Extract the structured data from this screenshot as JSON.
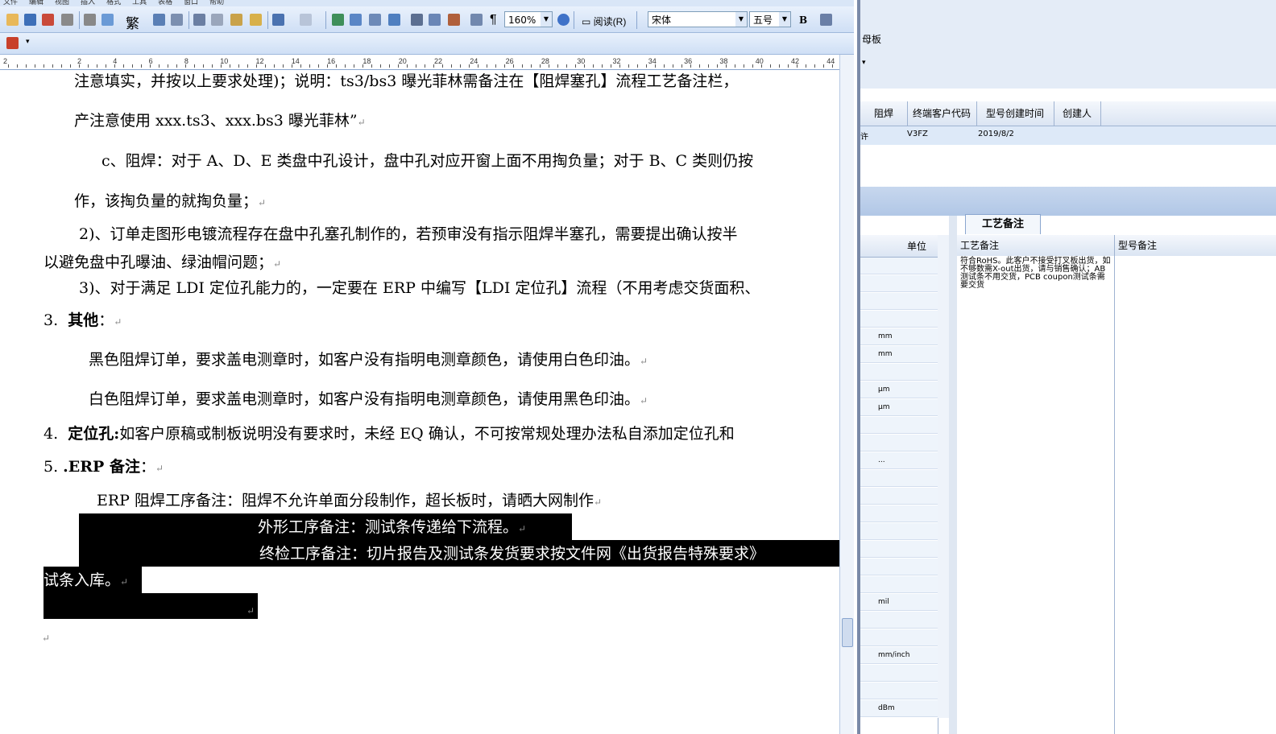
{
  "toolbar": {
    "zoom": "160%",
    "read_button": "阅读(R)",
    "font_name": "宋体",
    "font_size": "五号",
    "bold": "B",
    "trad": "繁"
  },
  "ruler": [
    "2",
    "2",
    "4",
    "6",
    "8",
    "10",
    "12",
    "14",
    "16",
    "18",
    "20",
    "22",
    "24",
    "26",
    "28",
    "30",
    "32",
    "34",
    "36",
    "38",
    "40",
    "42",
    "44"
  ],
  "document": {
    "line1": "注意填实，并按以上要求处理)；说明：ts3/bs3 曝光菲林需备注在【阻焊塞孔】流程工艺备注栏，",
    "line2": "产注意使用 xxx.ts3、xxx.bs3 曝光菲林”",
    "line3": "c、阻焊：对于 A、D、E 类盘中孔设计，盘中孔对应开窗上面不用掏负量；对于 B、C 类则仍按",
    "line4": "作，该掏负量的就掏负量；",
    "line5": "2)、订单走图形电镀流程存在盘中孔塞孔制作的，若预审没有指示阻焊半塞孔，需要提出确认按半",
    "line6": "以避免盘中孔曝油、绿油帽问题；",
    "line7": "3)、对于满足 LDI 定位孔能力的，一定要在 ERP 中编写【LDI 定位孔】流程（不用考虑交货面积、",
    "h3_num": "3.",
    "h3_title": "其他",
    "h3_colon": "：",
    "line9": "黑色阻焊订单，要求盖电测章时，如客户没有指明电测章颜色，请使用白色印油。",
    "line10": "白色阻焊订单，要求盖电测章时，如客户没有指明电测章颜色，请使用黑色印油。",
    "h4_num": "4.",
    "h4_title": "定位孔:",
    "h4_text": "如客户原稿或制板说明没有要求时，未经 EQ 确认，不可按常规处理办法私自添加定位孔和",
    "h5_num": "5. ",
    "h5_title": ".ERP 备注",
    "h5_colon": "：",
    "line12": "ERP 阻焊工序备注：阻焊不允许单面分段制作，超长板时，请晒大网制作",
    "line13": "外形工序备注：测试条传递给下流程。",
    "line14": "终检工序备注：切片报告及测试条发货要求按文件网《出货报告特殊要求》",
    "line15": "试条入库。",
    "pilcrow": "↵"
  },
  "erp": {
    "top_label": "母板",
    "columns": [
      "阻焊",
      "终端客户代码",
      "型号创建时间",
      "创建人"
    ],
    "row": {
      "c0": "许",
      "customer_code": "V3FZ",
      "created": "2019/8/2",
      "creator": ""
    },
    "tab_label": "工艺备注",
    "unit_header": "单位",
    "units": [
      "",
      "",
      "",
      "",
      "mm",
      "mm",
      "",
      "μm",
      "μm",
      "",
      "",
      "...",
      "",
      "",
      "",
      "",
      "",
      "",
      "",
      "mil",
      "",
      "",
      "mm/inch",
      "",
      "",
      "dBm"
    ],
    "notes_header_1": "工艺备注",
    "notes_header_2": "型号备注",
    "process_note": "符合RoHS。此客户不接受打叉板出货，如不够数需X-out出货，请与销售确认；AB测试条不用交货，PCB coupon测试条需要交货"
  },
  "colors": {
    "toolbar_light": "#e9f1fc",
    "toolbar_dark": "#cfdff5",
    "erp_band": "#b1c7e6",
    "selection": "#000000"
  }
}
